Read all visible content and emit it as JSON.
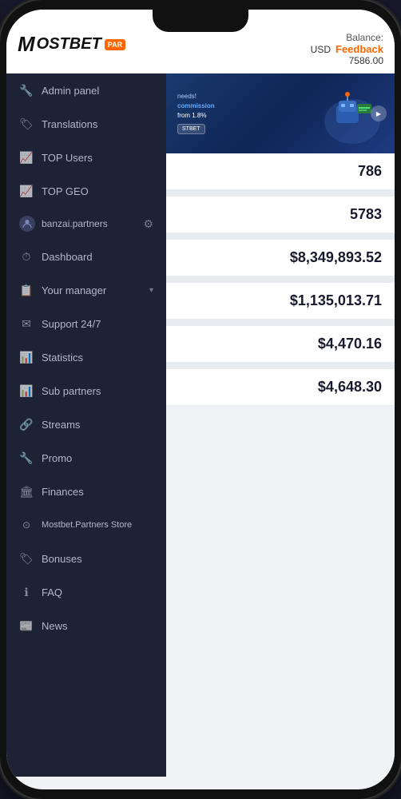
{
  "phone": {
    "header": {
      "logo_m": "M",
      "logo_rest": "OSTBET",
      "logo_badge": "PAR",
      "balance_label": "Balance:",
      "currency": "USD",
      "amount": "7586.00",
      "feedback": "Feedback"
    },
    "sidebar": {
      "items": [
        {
          "id": "admin-panel",
          "label": "Admin panel",
          "icon": "🔧"
        },
        {
          "id": "translations",
          "label": "Translations",
          "icon": "🏷"
        },
        {
          "id": "top-users",
          "label": "TOP Users",
          "icon": "📈"
        },
        {
          "id": "top-geo",
          "label": "TOP GEO",
          "icon": "📈"
        },
        {
          "id": "banzai-partners",
          "label": "banzai.partners",
          "icon": "👤",
          "has_gear": true
        },
        {
          "id": "dashboard",
          "label": "Dashboard",
          "icon": "⏱"
        },
        {
          "id": "your-manager",
          "label": "Your manager",
          "icon": "📋",
          "has_chevron": true
        },
        {
          "id": "support-247",
          "label": "Support 24/7",
          "icon": "✉"
        },
        {
          "id": "statistics",
          "label": "Statistics",
          "icon": "📊"
        },
        {
          "id": "sub-partners",
          "label": "Sub partners",
          "icon": "📊"
        },
        {
          "id": "streams",
          "label": "Streams",
          "icon": "🔗"
        },
        {
          "id": "promo",
          "label": "Promo",
          "icon": "🔧"
        },
        {
          "id": "finances",
          "label": "Finances",
          "icon": "🏛"
        },
        {
          "id": "mostbet-store",
          "label": "Mostbet.Partners Store",
          "icon": "⊙"
        },
        {
          "id": "bonuses",
          "label": "Bonuses",
          "icon": "🏷"
        },
        {
          "id": "faq",
          "label": "FAQ",
          "icon": "ℹ"
        },
        {
          "id": "news",
          "label": "News",
          "icon": "📰"
        }
      ]
    },
    "content": {
      "banner": {
        "tag_text": "needs!",
        "highlight_text": "commission",
        "highlight_value": "from 1.8%",
        "brand_badge": "STBET"
      },
      "stats": [
        {
          "value": "786",
          "label": ""
        },
        {
          "value": "5783",
          "label": ""
        },
        {
          "value": "$8,349,893.52",
          "label": ""
        },
        {
          "value": "$1,135,013.71",
          "label": ""
        },
        {
          "value": "$4,470.16",
          "label": ""
        },
        {
          "value": "$4,648.30",
          "label": ""
        }
      ]
    }
  }
}
